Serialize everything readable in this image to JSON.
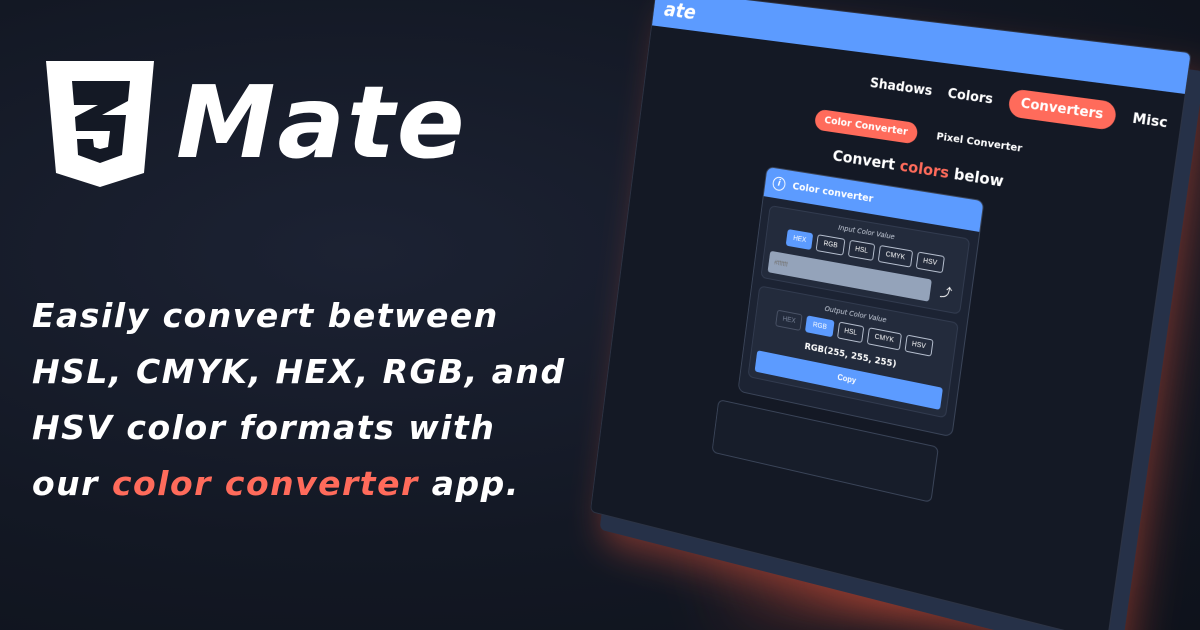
{
  "brand": {
    "name": "Mate",
    "shield_digit": "3"
  },
  "tagline": {
    "before": "Easily convert between HSL, CMYK, HEX, RGB, and HSV color formats with our ",
    "highlight": "color converter",
    "after": " app."
  },
  "app": {
    "logo": "ate",
    "nav": [
      {
        "label": "Shadows"
      },
      {
        "label": "Colors"
      },
      {
        "label": "Converters"
      },
      {
        "label": "Misc"
      }
    ],
    "subnav": [
      {
        "label": "Color Converter"
      },
      {
        "label": "Pixel Converter"
      }
    ],
    "heading": {
      "before": "Convert ",
      "highlight": "colors",
      "after": " below"
    },
    "card": {
      "title": "Color converter",
      "input": {
        "title": "Input Color Value",
        "formats": [
          "HEX",
          "RGB",
          "HSL",
          "CMYK",
          "HSV"
        ],
        "placeholder": "#ffffff"
      },
      "output": {
        "title": "Output Color Value",
        "formats": [
          "HEX",
          "RGB",
          "HSL",
          "CMYK",
          "HSV"
        ],
        "value": "RGB(255, 255, 255)",
        "copy_label": "Copy"
      }
    }
  },
  "colors": {
    "accent": "#ff6b5b",
    "primary": "#5c9bff",
    "background": "#131824"
  }
}
